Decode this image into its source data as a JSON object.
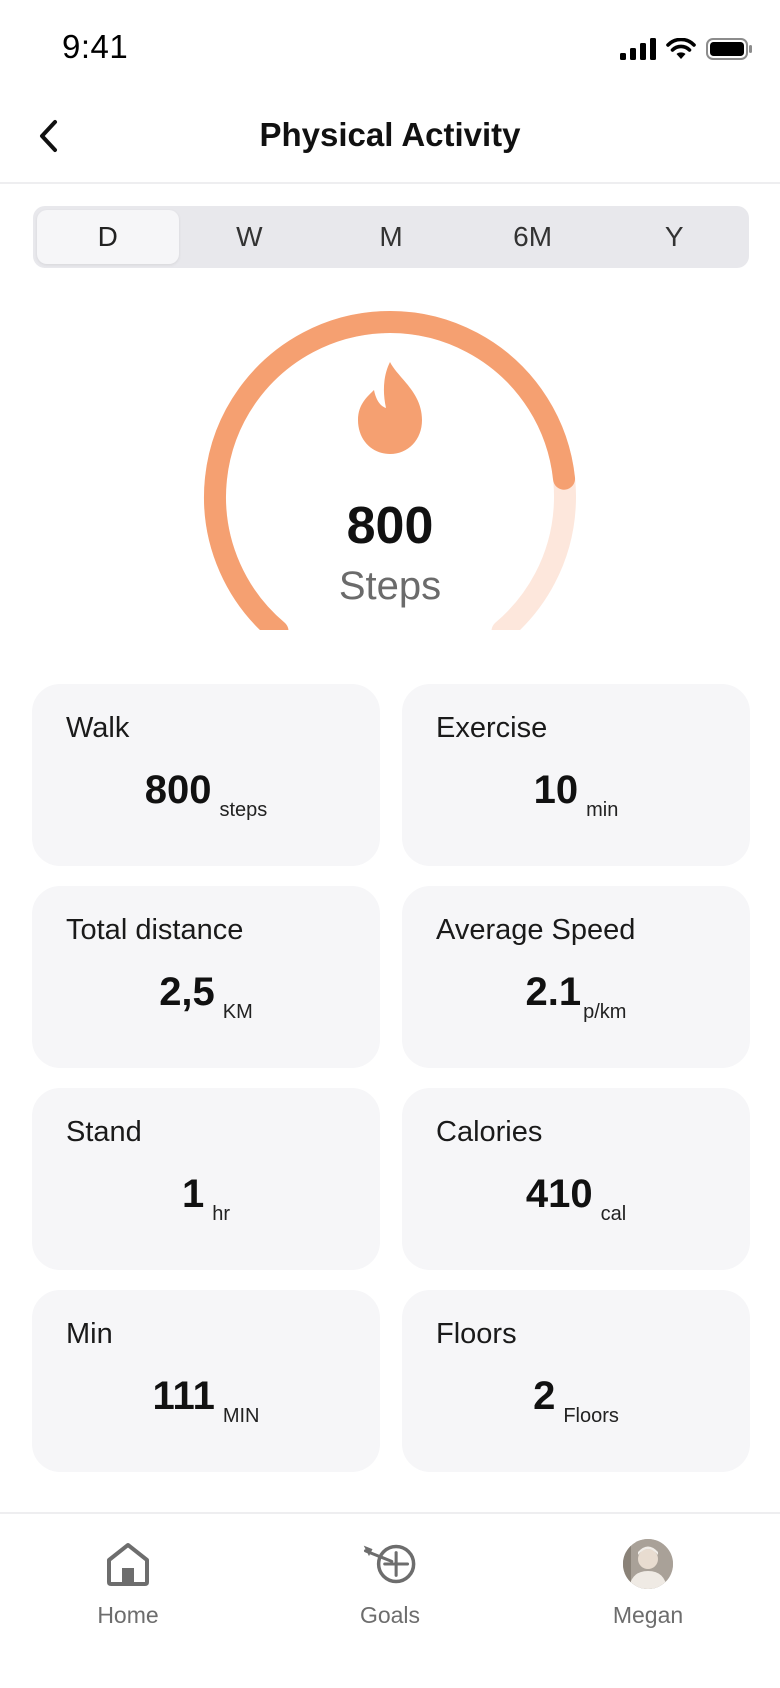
{
  "status_bar": {
    "time": "9:41"
  },
  "header": {
    "title": "Physical Activity"
  },
  "segments": [
    {
      "label": "D",
      "active": true
    },
    {
      "label": "W",
      "active": false
    },
    {
      "label": "M",
      "active": false
    },
    {
      "label": "6M",
      "active": false
    },
    {
      "label": "Y",
      "active": false
    }
  ],
  "gauge": {
    "value": "800",
    "label": "Steps",
    "progress": 0.8,
    "accent": "#f5a071",
    "track": "#fde7dc"
  },
  "cards": [
    {
      "title": "Walk",
      "value": "800",
      "unit": "steps"
    },
    {
      "title": "Exercise",
      "value": "10",
      "unit": "min"
    },
    {
      "title": "Total distance",
      "value": "2,5",
      "unit": "KM"
    },
    {
      "title": "Average Speed",
      "value": "2.1",
      "unit": "p/km"
    },
    {
      "title": "Stand",
      "value": "1",
      "unit": "hr"
    },
    {
      "title": "Calories",
      "value": "410",
      "unit": "cal"
    },
    {
      "title": "Min",
      "value": "111",
      "unit": "MIN"
    },
    {
      "title": "Floors",
      "value": "2",
      "unit": "Floors"
    }
  ],
  "tabbar": {
    "home": {
      "label": "Home",
      "icon": "home-icon"
    },
    "goals": {
      "label": "Goals",
      "icon": "target-icon"
    },
    "profile": {
      "label": "Megan",
      "icon": "avatar"
    }
  }
}
